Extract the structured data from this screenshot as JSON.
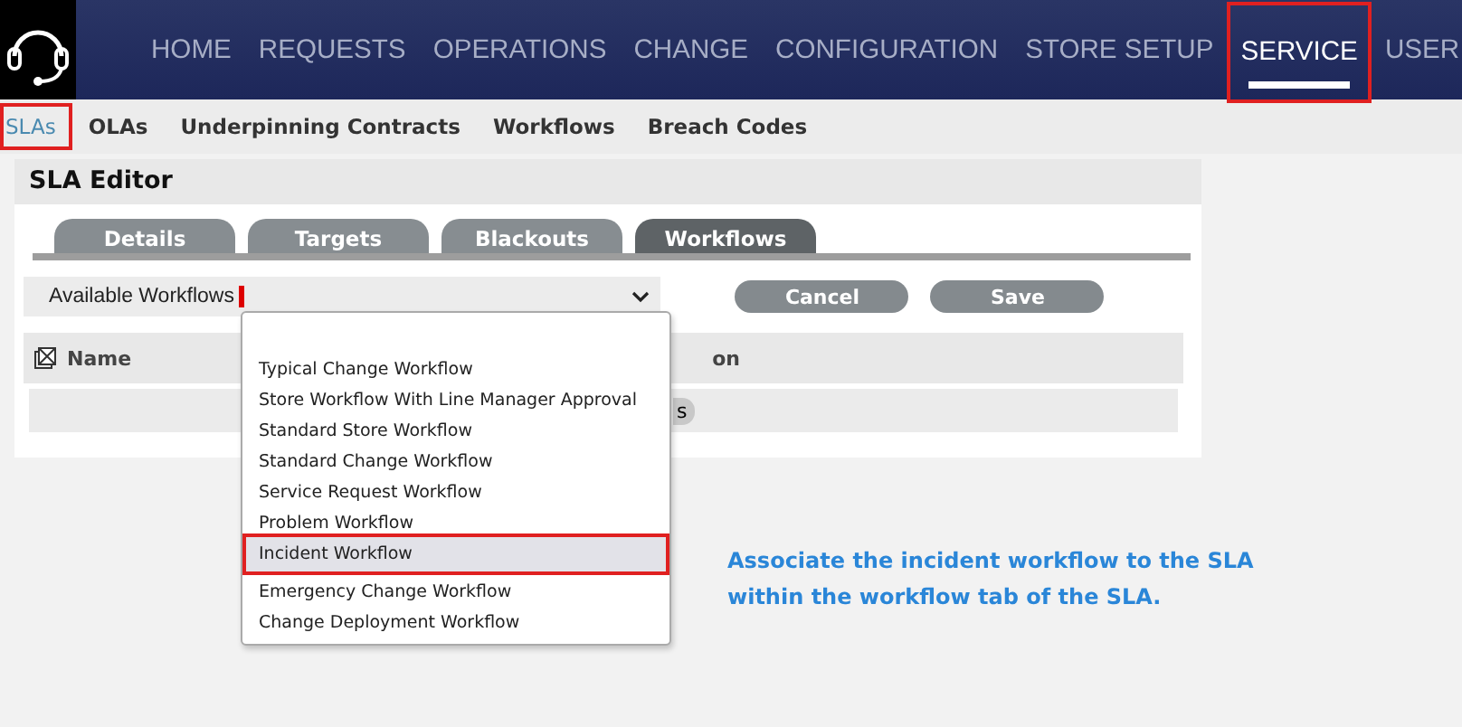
{
  "nav": {
    "items": [
      {
        "label": "HOME",
        "selected": false,
        "highlighted": false
      },
      {
        "label": "REQUESTS",
        "selected": false,
        "highlighted": false
      },
      {
        "label": "OPERATIONS",
        "selected": false,
        "highlighted": false
      },
      {
        "label": "CHANGE",
        "selected": false,
        "highlighted": false
      },
      {
        "label": "CONFIGURATION",
        "selected": false,
        "highlighted": false
      },
      {
        "label": "STORE SETUP",
        "selected": false,
        "highlighted": false
      },
      {
        "label": "SERVICE",
        "selected": true,
        "highlighted": true
      },
      {
        "label": "USER",
        "selected": false,
        "highlighted": false
      }
    ]
  },
  "subnav": {
    "items": [
      {
        "label": "SLAs",
        "selected": true,
        "highlighted": true
      },
      {
        "label": "OLAs",
        "selected": false,
        "highlighted": false
      },
      {
        "label": "Underpinning Contracts",
        "selected": false,
        "highlighted": false
      },
      {
        "label": "Workflows",
        "selected": false,
        "highlighted": false
      },
      {
        "label": "Breach Codes",
        "selected": false,
        "highlighted": false
      }
    ]
  },
  "editor": {
    "title": "SLA Editor",
    "tabs": [
      {
        "label": "Details",
        "selected": false
      },
      {
        "label": "Targets",
        "selected": false
      },
      {
        "label": "Blackouts",
        "selected": false
      },
      {
        "label": "Workflows",
        "selected": true
      }
    ],
    "field": {
      "label": "Available Workflows",
      "required": true,
      "expanded": true
    },
    "buttons": [
      "Cancel",
      "Save"
    ],
    "table": {
      "columns": [
        "Name",
        "on"
      ],
      "rows": [
        {
          "column_2": "s"
        }
      ]
    },
    "dropdown": {
      "options": [
        {
          "label": "Typical Change Workflow",
          "selected": false,
          "highlighted": false
        },
        {
          "label": "Store Workflow With Line Manager Approval",
          "selected": false,
          "highlighted": false
        },
        {
          "label": "Standard Store Workflow",
          "selected": false,
          "highlighted": false
        },
        {
          "label": "Standard Change Workflow",
          "selected": false,
          "highlighted": false
        },
        {
          "label": "Service Request Workflow",
          "selected": false,
          "highlighted": false
        },
        {
          "label": "Problem Workflow",
          "selected": false,
          "highlighted": false
        },
        {
          "label": "Incident Workflow",
          "selected": true,
          "highlighted": true
        },
        {
          "label": "Emergency Change Workflow",
          "selected": false,
          "highlighted": false
        },
        {
          "label": "Change Deployment Workflow",
          "selected": false,
          "highlighted": false
        }
      ]
    }
  },
  "note": "Associate the incident workflow to the SLA within the workflow tab of the SLA."
}
